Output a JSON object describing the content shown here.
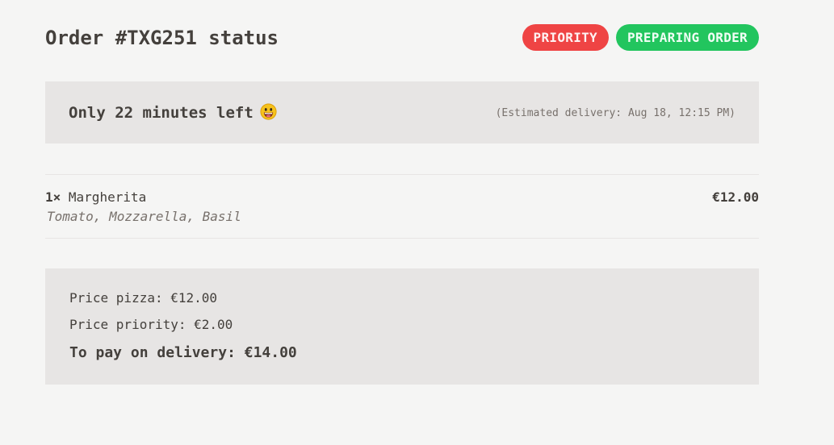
{
  "header": {
    "title": "Order #TXG251 status",
    "badges": {
      "priority": "PRIORITY",
      "status": "PREPARING ORDER"
    }
  },
  "countdown": {
    "text": "Only 22 minutes left",
    "emoji": "grinning-face",
    "delivery": "(Estimated delivery: Aug 18, 12:15 PM)"
  },
  "items": [
    {
      "quantity": "1×",
      "name": "Margherita",
      "price": "€12.00",
      "ingredients": "Tomato, Mozzarella, Basil"
    }
  ],
  "summary": {
    "price_pizza": "Price pizza: €12.00",
    "price_priority": "Price priority: €2.00",
    "total": "To pay on delivery: €14.00"
  },
  "colors": {
    "background": "#f5f5f4",
    "panel": "#e7e5e4",
    "text": "#44403c",
    "muted": "#78716c",
    "priority_badge": "#ef4444",
    "status_badge": "#22c55e"
  }
}
